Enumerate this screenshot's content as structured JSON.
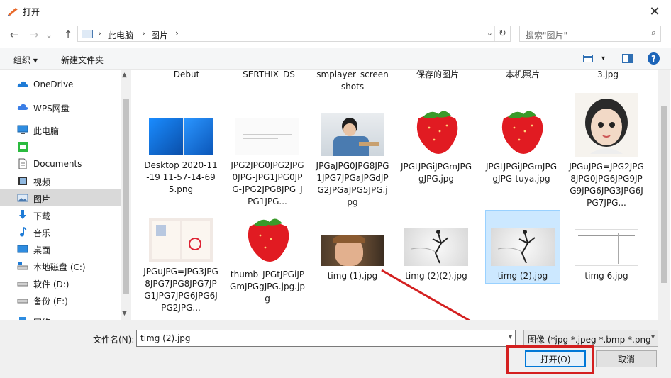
{
  "window": {
    "title": "打开",
    "close_glyph": "✕"
  },
  "nav": {
    "back": "←",
    "forward": "→",
    "recent": "⌄",
    "up": "↑",
    "breadcrumb": [
      "此电脑",
      "图片"
    ],
    "separator": "›",
    "search_placeholder": "搜索\"图片\""
  },
  "toolbar": {
    "organize": "组织 ▾",
    "new_folder": "新建文件夹",
    "help": "?"
  },
  "sidebar": {
    "items": [
      {
        "label": "OneDrive",
        "icon": "cloud-icon"
      },
      {
        "label": "WPS网盘",
        "icon": "wps-cloud-icon"
      },
      {
        "label": "此电脑",
        "icon": "computer-icon"
      },
      {
        "label": "",
        "icon": "wechat-folder-icon"
      },
      {
        "label": "Documents",
        "icon": "document-icon"
      },
      {
        "label": "视频",
        "icon": "video-icon"
      },
      {
        "label": "图片",
        "icon": "picture-icon",
        "selected": true
      },
      {
        "label": "下载",
        "icon": "download-icon"
      },
      {
        "label": "音乐",
        "icon": "music-icon"
      },
      {
        "label": "桌面",
        "icon": "desktop-icon"
      },
      {
        "label": "本地磁盘 (C:)",
        "icon": "drive-c-icon"
      },
      {
        "label": "软件 (D:)",
        "icon": "drive-icon"
      },
      {
        "label": "备份 (E:)",
        "icon": "drive-icon"
      },
      {
        "label": "网络",
        "icon": "network-icon"
      }
    ]
  },
  "files": {
    "top_row_partial": [
      "Debut",
      "SERTHIX_DS",
      "smplayer_screenshots",
      "保存的图片",
      "本机照片",
      "3.jpg"
    ],
    "row1": [
      {
        "name": "Desktop 2020-11-19 11-57-14-695.png",
        "thumb": "desktop"
      },
      {
        "name": "JPG2JPG0JPG2JPG0JPG-JPG1JPG0JPG-JPG2JPG8JPG_JPG1JPG...",
        "thumb": "document"
      },
      {
        "name": "JPGaJPG0JPG8JPG1JPG7JPGaJPGdJPG2JPGaJPG5JPG.jpg",
        "thumb": "boy"
      },
      {
        "name": "JPGtJPGiJPGmJPGgJPG.jpg",
        "thumb": "strawberry"
      },
      {
        "name": "JPGtJPGiJPGmJPGgJPG-tuya.jpg",
        "thumb": "strawberry"
      },
      {
        "name": "JPGuJPG=JPG2JPG8JPG0JPG6JPG9JPG9JPG6JPG3JPG6JPG7JPG...",
        "thumb": "girl"
      }
    ],
    "row2": [
      {
        "name": "JPGuJPG=JPG3JPG8JPG7JPG8JPG7JPG1JPG7JPG6JPG6JPG2JPG...",
        "thumb": "certificate"
      },
      {
        "name": "thumb_JPGtJPGiJPGmJPGgJPG.jpg.jpg",
        "thumb": "strawberry"
      },
      {
        "name": "timg (1).jpg",
        "thumb": "kid"
      },
      {
        "name": "timg (2)(2).jpg",
        "thumb": "dancer"
      },
      {
        "name": "timg (2).jpg",
        "thumb": "dancer",
        "selected": true
      },
      {
        "name": "timg 6.jpg",
        "thumb": "form"
      }
    ]
  },
  "bottom": {
    "filename_label": "文件名(N):",
    "filename_value": "timg (2).jpg",
    "filter_value": "图像 (*jpg *.jpeg *.bmp *.png",
    "open_button": "打开(O)",
    "cancel_button": "取消"
  },
  "colors": {
    "accent": "#0078d7",
    "selection": "#cce8ff",
    "annotation_red": "#d42020"
  }
}
